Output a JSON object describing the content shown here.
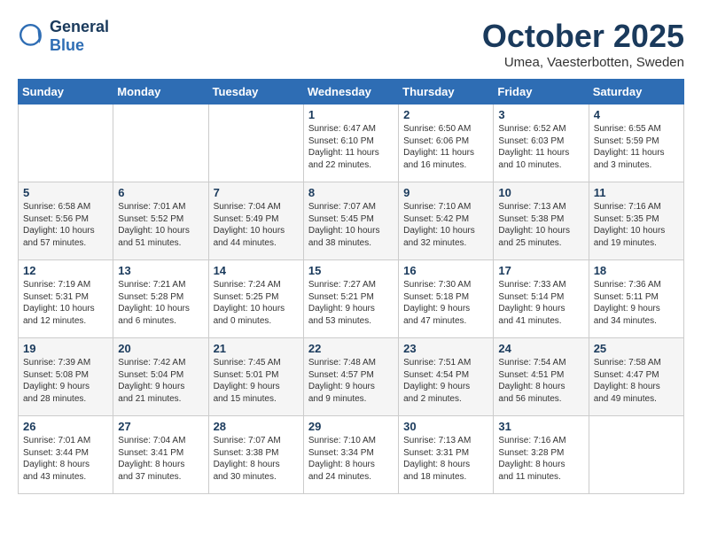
{
  "header": {
    "logo_line1": "General",
    "logo_line2": "Blue",
    "month": "October 2025",
    "location": "Umea, Vaesterbotten, Sweden"
  },
  "weekdays": [
    "Sunday",
    "Monday",
    "Tuesday",
    "Wednesday",
    "Thursday",
    "Friday",
    "Saturday"
  ],
  "weeks": [
    [
      {
        "day": "",
        "info": ""
      },
      {
        "day": "",
        "info": ""
      },
      {
        "day": "",
        "info": ""
      },
      {
        "day": "1",
        "info": "Sunrise: 6:47 AM\nSunset: 6:10 PM\nDaylight: 11 hours\nand 22 minutes."
      },
      {
        "day": "2",
        "info": "Sunrise: 6:50 AM\nSunset: 6:06 PM\nDaylight: 11 hours\nand 16 minutes."
      },
      {
        "day": "3",
        "info": "Sunrise: 6:52 AM\nSunset: 6:03 PM\nDaylight: 11 hours\nand 10 minutes."
      },
      {
        "day": "4",
        "info": "Sunrise: 6:55 AM\nSunset: 5:59 PM\nDaylight: 11 hours\nand 3 minutes."
      }
    ],
    [
      {
        "day": "5",
        "info": "Sunrise: 6:58 AM\nSunset: 5:56 PM\nDaylight: 10 hours\nand 57 minutes."
      },
      {
        "day": "6",
        "info": "Sunrise: 7:01 AM\nSunset: 5:52 PM\nDaylight: 10 hours\nand 51 minutes."
      },
      {
        "day": "7",
        "info": "Sunrise: 7:04 AM\nSunset: 5:49 PM\nDaylight: 10 hours\nand 44 minutes."
      },
      {
        "day": "8",
        "info": "Sunrise: 7:07 AM\nSunset: 5:45 PM\nDaylight: 10 hours\nand 38 minutes."
      },
      {
        "day": "9",
        "info": "Sunrise: 7:10 AM\nSunset: 5:42 PM\nDaylight: 10 hours\nand 32 minutes."
      },
      {
        "day": "10",
        "info": "Sunrise: 7:13 AM\nSunset: 5:38 PM\nDaylight: 10 hours\nand 25 minutes."
      },
      {
        "day": "11",
        "info": "Sunrise: 7:16 AM\nSunset: 5:35 PM\nDaylight: 10 hours\nand 19 minutes."
      }
    ],
    [
      {
        "day": "12",
        "info": "Sunrise: 7:19 AM\nSunset: 5:31 PM\nDaylight: 10 hours\nand 12 minutes."
      },
      {
        "day": "13",
        "info": "Sunrise: 7:21 AM\nSunset: 5:28 PM\nDaylight: 10 hours\nand 6 minutes."
      },
      {
        "day": "14",
        "info": "Sunrise: 7:24 AM\nSunset: 5:25 PM\nDaylight: 10 hours\nand 0 minutes."
      },
      {
        "day": "15",
        "info": "Sunrise: 7:27 AM\nSunset: 5:21 PM\nDaylight: 9 hours\nand 53 minutes."
      },
      {
        "day": "16",
        "info": "Sunrise: 7:30 AM\nSunset: 5:18 PM\nDaylight: 9 hours\nand 47 minutes."
      },
      {
        "day": "17",
        "info": "Sunrise: 7:33 AM\nSunset: 5:14 PM\nDaylight: 9 hours\nand 41 minutes."
      },
      {
        "day": "18",
        "info": "Sunrise: 7:36 AM\nSunset: 5:11 PM\nDaylight: 9 hours\nand 34 minutes."
      }
    ],
    [
      {
        "day": "19",
        "info": "Sunrise: 7:39 AM\nSunset: 5:08 PM\nDaylight: 9 hours\nand 28 minutes."
      },
      {
        "day": "20",
        "info": "Sunrise: 7:42 AM\nSunset: 5:04 PM\nDaylight: 9 hours\nand 21 minutes."
      },
      {
        "day": "21",
        "info": "Sunrise: 7:45 AM\nSunset: 5:01 PM\nDaylight: 9 hours\nand 15 minutes."
      },
      {
        "day": "22",
        "info": "Sunrise: 7:48 AM\nSunset: 4:57 PM\nDaylight: 9 hours\nand 9 minutes."
      },
      {
        "day": "23",
        "info": "Sunrise: 7:51 AM\nSunset: 4:54 PM\nDaylight: 9 hours\nand 2 minutes."
      },
      {
        "day": "24",
        "info": "Sunrise: 7:54 AM\nSunset: 4:51 PM\nDaylight: 8 hours\nand 56 minutes."
      },
      {
        "day": "25",
        "info": "Sunrise: 7:58 AM\nSunset: 4:47 PM\nDaylight: 8 hours\nand 49 minutes."
      }
    ],
    [
      {
        "day": "26",
        "info": "Sunrise: 7:01 AM\nSunset: 3:44 PM\nDaylight: 8 hours\nand 43 minutes."
      },
      {
        "day": "27",
        "info": "Sunrise: 7:04 AM\nSunset: 3:41 PM\nDaylight: 8 hours\nand 37 minutes."
      },
      {
        "day": "28",
        "info": "Sunrise: 7:07 AM\nSunset: 3:38 PM\nDaylight: 8 hours\nand 30 minutes."
      },
      {
        "day": "29",
        "info": "Sunrise: 7:10 AM\nSunset: 3:34 PM\nDaylight: 8 hours\nand 24 minutes."
      },
      {
        "day": "30",
        "info": "Sunrise: 7:13 AM\nSunset: 3:31 PM\nDaylight: 8 hours\nand 18 minutes."
      },
      {
        "day": "31",
        "info": "Sunrise: 7:16 AM\nSunset: 3:28 PM\nDaylight: 8 hours\nand 11 minutes."
      },
      {
        "day": "",
        "info": ""
      }
    ]
  ]
}
